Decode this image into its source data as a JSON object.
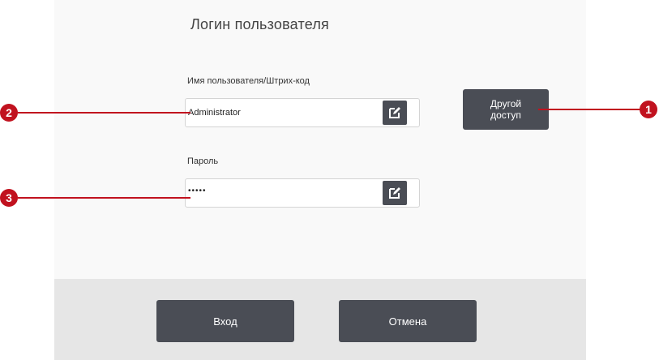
{
  "dialog": {
    "title": "Логин пользователя",
    "username_label": "Имя пользователя/Штрих-код",
    "username_value": "Administrator",
    "password_label": "Пароль",
    "password_value": "•••••",
    "alt_access_label": "Другой\nдоступ",
    "login_label": "Вход",
    "cancel_label": "Отмена"
  },
  "callouts": [
    "1",
    "2",
    "3"
  ],
  "colors": {
    "button": "#4a4d55",
    "callout": "#c1121f",
    "footer": "#e6e6e6"
  }
}
